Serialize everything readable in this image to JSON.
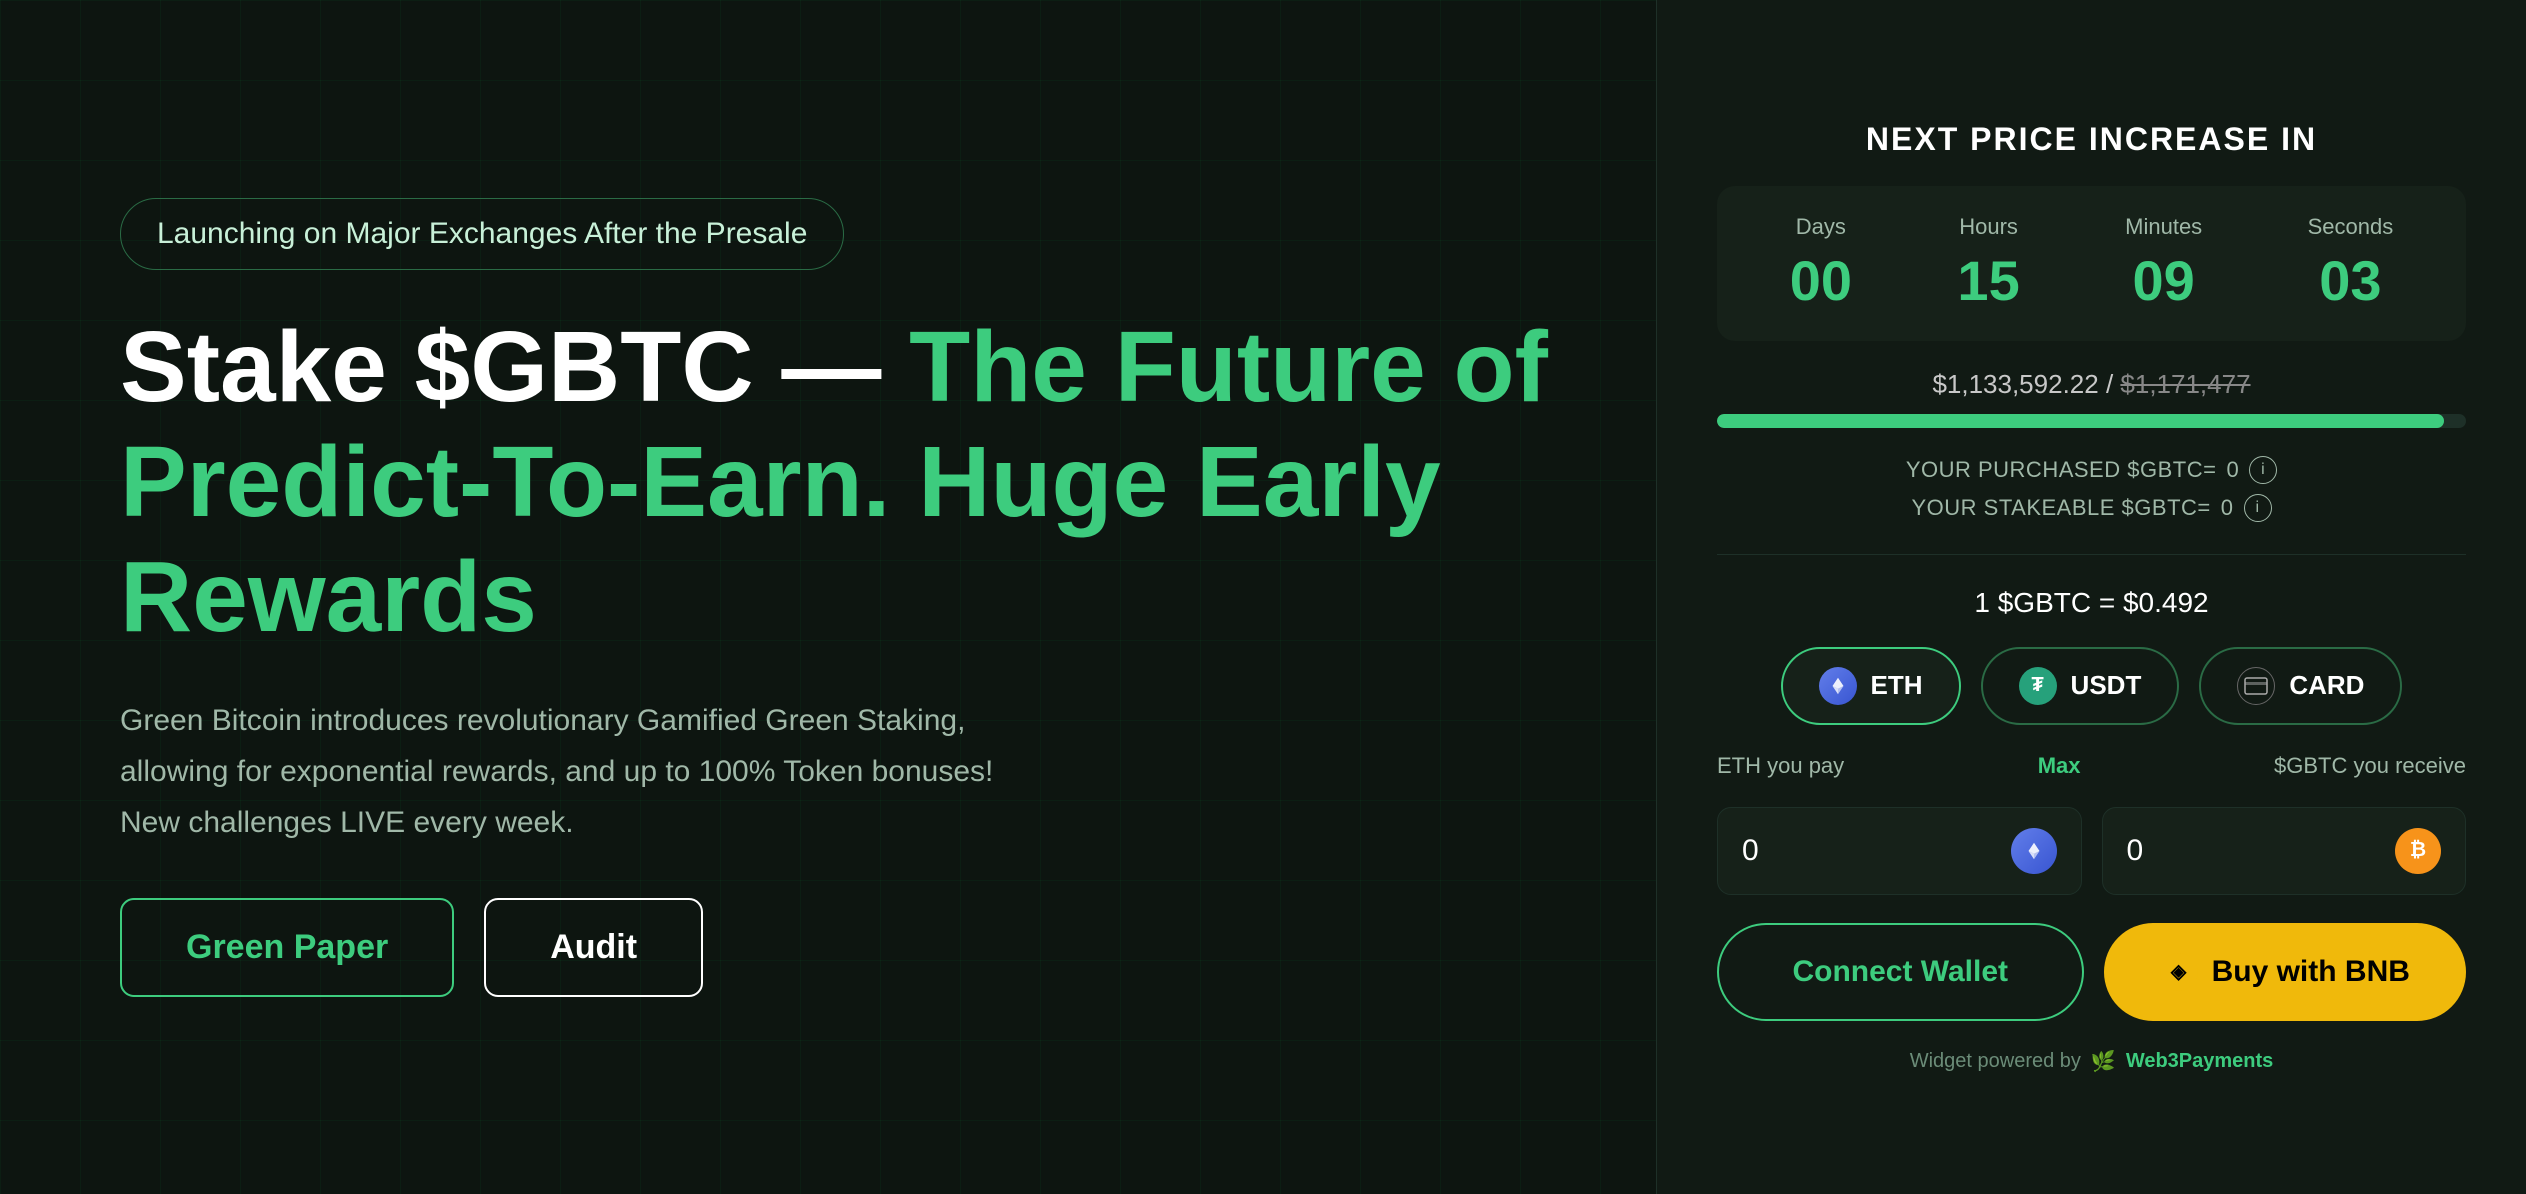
{
  "badge": {
    "text": "Launching on Major Exchanges After the Presale"
  },
  "heading": {
    "part1": "Stake $GBTC — ",
    "part2": "The Future of Predict-To-Earn. Huge Early Rewards"
  },
  "description": "Green Bitcoin introduces revolutionary Gamified Green Staking, allowing for exponential rewards, and up to 100% Token bonuses! New challenges LIVE every week.",
  "buttons": {
    "green_paper": "Green Paper",
    "audit": "Audit"
  },
  "widget": {
    "title": "NEXT PRICE INCREASE IN",
    "countdown": {
      "days_label": "Days",
      "days_value": "00",
      "hours_label": "Hours",
      "hours_value": "15",
      "minutes_label": "Minutes",
      "minutes_value": "09",
      "seconds_label": "Seconds",
      "seconds_value": "03"
    },
    "progress": {
      "current": "$1,133,592.22",
      "target": "$1,171,477",
      "percent": 97
    },
    "purchased_label": "YOUR PURCHASED $GBTC=",
    "purchased_value": "0",
    "stakeable_label": "YOUR STAKEABLE $GBTC=",
    "stakeable_value": "0",
    "price": "1 $GBTC = $0.492",
    "tabs": [
      {
        "id": "eth",
        "label": "ETH",
        "icon": "ETH"
      },
      {
        "id": "usdt",
        "label": "USDT",
        "icon": "T"
      },
      {
        "id": "card",
        "label": "CARD",
        "icon": "💳"
      }
    ],
    "pay_label": "ETH you pay",
    "max_label": "Max",
    "receive_label": "$GBTC you receive",
    "pay_value": "0",
    "receive_value": "0",
    "connect_wallet": "Connect Wallet",
    "buy_bnb": "Buy with BNB",
    "powered_by_text": "Widget powered by",
    "powered_by_brand": "Web3Payments"
  }
}
